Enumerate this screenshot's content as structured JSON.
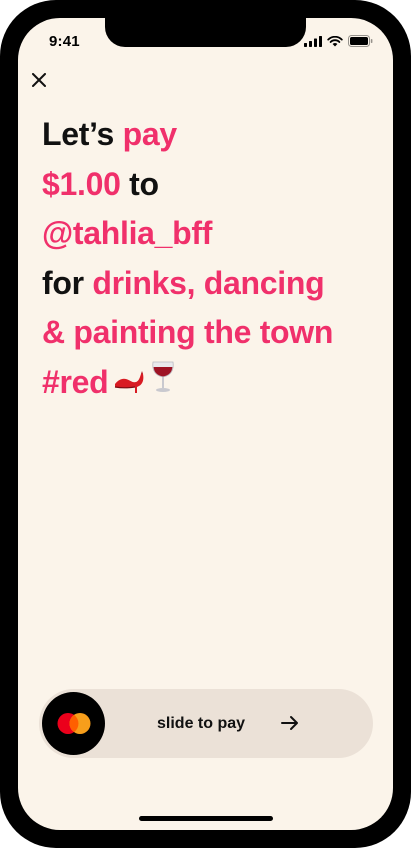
{
  "status_bar": {
    "time": "9:41",
    "icons": [
      "signal-icon",
      "wifi-icon",
      "battery-icon"
    ]
  },
  "close_icon": "close-icon",
  "message": {
    "lines": [
      [
        {
          "text": "Let’s ",
          "accent": false
        },
        {
          "text": "pay",
          "accent": true
        }
      ],
      [
        {
          "text": "$1.00",
          "accent": true
        },
        {
          "text": " to",
          "accent": false
        }
      ],
      [
        {
          "text": "@tahlia_bff",
          "accent": true
        }
      ],
      [
        {
          "text": "for ",
          "accent": false
        },
        {
          "text": "drinks, dancing",
          "accent": true
        }
      ],
      [
        {
          "text": "& painting the town",
          "accent": true
        }
      ],
      [
        {
          "text": "#red",
          "accent": true
        }
      ]
    ],
    "emojis": [
      "high-heel-emoji",
      "wine-glass-emoji"
    ]
  },
  "slider": {
    "label": "slide to pay",
    "knob_icon": "mastercard-logo",
    "arrow_icon": "arrow-right-icon"
  },
  "colors": {
    "background": "#fbf4ea",
    "accent": "#f0306b",
    "slider_track": "#ebe1d7",
    "text": "#111111"
  }
}
